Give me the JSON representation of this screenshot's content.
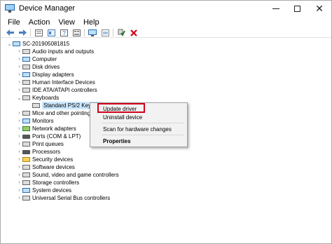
{
  "window": {
    "title": "Device Manager",
    "minimize_icon": "minimize-icon",
    "maximize_icon": "maximize-icon",
    "close_glyph": "✕"
  },
  "menu": {
    "items": [
      "File",
      "Action",
      "View",
      "Help"
    ]
  },
  "toolbar": {
    "buttons": [
      "back-arrow-icon",
      "forward-arrow-icon",
      "properties-icon",
      "help-icon",
      "show-hidden-icon",
      "update-driver-icon",
      "scan-hardware-icon",
      "enable-device-icon",
      "uninstall-icon"
    ],
    "uninstall_color": "#d0021b",
    "enable_color": "#2e7d32"
  },
  "tree": {
    "root": "SC-201905081815",
    "categories": [
      {
        "label": "Audio inputs and outputs",
        "icon": "speaker-icon"
      },
      {
        "label": "Computer",
        "icon": "computer-icon"
      },
      {
        "label": "Disk drives",
        "icon": "disk-drive-icon"
      },
      {
        "label": "Display adapters",
        "icon": "display-adapter-icon"
      },
      {
        "label": "Human Interface Devices",
        "icon": "hid-icon"
      },
      {
        "label": "IDE ATA/ATAPI controllers",
        "icon": "ide-controller-icon"
      },
      {
        "label": "Keyboards",
        "icon": "keyboard-icon",
        "expanded": true
      },
      {
        "label": "Mice and other pointing d",
        "icon": "mouse-icon"
      },
      {
        "label": "Monitors",
        "icon": "monitor-icon"
      },
      {
        "label": "Network adapters",
        "icon": "network-adapter-icon"
      },
      {
        "label": "Ports (COM & LPT)",
        "icon": "port-icon"
      },
      {
        "label": "Print queues",
        "icon": "printer-icon"
      },
      {
        "label": "Processors",
        "icon": "processor-icon"
      },
      {
        "label": "Security devices",
        "icon": "security-device-icon"
      },
      {
        "label": "Software devices",
        "icon": "software-device-icon"
      },
      {
        "label": "Sound, video and game controllers",
        "icon": "sound-controller-icon"
      },
      {
        "label": "Storage controllers",
        "icon": "storage-controller-icon"
      },
      {
        "label": "System devices",
        "icon": "system-device-icon"
      },
      {
        "label": "Universal Serial Bus controllers",
        "icon": "usb-icon"
      }
    ],
    "keyboard_child": "Standard PS/2 Keyboa"
  },
  "context_menu": {
    "update_driver": "Update driver",
    "uninstall_device": "Uninstall device",
    "scan_hardware": "Scan for hardware changes",
    "properties": "Properties",
    "highlight_color": "#d0021b"
  }
}
